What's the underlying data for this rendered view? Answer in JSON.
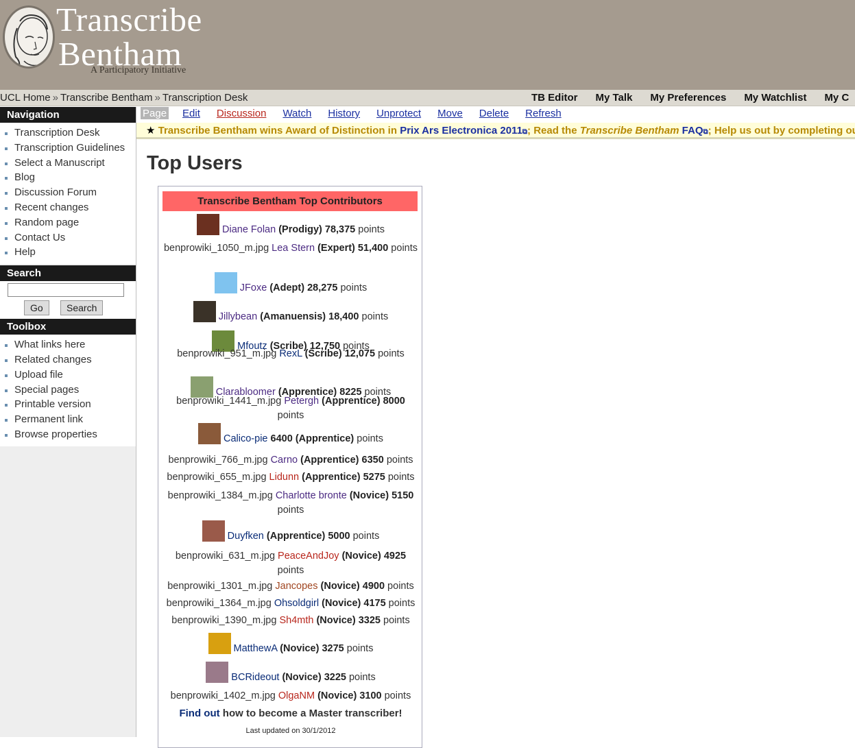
{
  "header": {
    "title_line1": "Transcribe",
    "title_line2": "Bentham",
    "tagline": "A Participatory Initiative"
  },
  "breadcrumb": [
    "UCL Home",
    "Transcribe Bentham",
    "Transcription Desk"
  ],
  "personal_links": [
    "TB Editor",
    "My Talk",
    "My Preferences",
    "My Watchlist",
    "My C"
  ],
  "sidebar": {
    "navigation": {
      "heading": "Navigation",
      "items": [
        "Transcription Desk",
        "Transcription Guidelines",
        "Select a Manuscript",
        "Blog",
        "Discussion Forum",
        "Recent changes",
        "Random page",
        "Contact Us",
        "Help"
      ]
    },
    "search": {
      "heading": "Search",
      "input_value": "",
      "go_label": "Go",
      "search_label": "Search"
    },
    "toolbox": {
      "heading": "Toolbox",
      "items": [
        "What links here",
        "Related changes",
        "Upload file",
        "Special pages",
        "Printable version",
        "Permanent link",
        "Browse properties"
      ]
    }
  },
  "tabs": [
    "Page",
    "Edit",
    "Discussion",
    "Watch",
    "History",
    "Unprotect",
    "Move",
    "Delete",
    "Refresh"
  ],
  "sitenotice": {
    "star": "★",
    "part1": "Transcribe Bentham wins Award of Distinction in ",
    "link1": "Prix Ars Electronica 2011",
    "part2": "; Read the ",
    "em": "Transcribe Bentham",
    "link2": " FAQ",
    "part3": "; Help us out by completing ou"
  },
  "page_title": "Top Users",
  "contributors": {
    "heading": "Transcribe Bentham Top Contributors",
    "entries": [
      {
        "prefix": "",
        "name": "Diane Folan",
        "color": "#4b2a82",
        "rank": "(Prodigy)",
        "points": "78,375",
        "rank_first": true,
        "avatar": "#6b3020"
      },
      {
        "prefix": "benprowiki_1050_m.jpg",
        "name": "Lea Stern",
        "color": "#4b2a82",
        "rank": "(Expert)",
        "points": "51,400",
        "rank_first": true,
        "avatar": ""
      },
      {
        "prefix": "",
        "name": "JFoxe",
        "color": "#4b2a82",
        "rank": "(Adept)",
        "points": "28,275",
        "rank_first": true,
        "avatar": "#7fc3ef"
      },
      {
        "prefix": "",
        "name": "Jillybean",
        "color": "#4b2a82",
        "rank": "(Amanuensis)",
        "points": "18,400",
        "rank_first": true,
        "avatar": "#3a3228"
      },
      {
        "prefix": "",
        "name": "Mfoutz",
        "color": "#0a2c77",
        "rank": "(Scribe)",
        "points": "12,750",
        "rank_first": true,
        "avatar": "#6c8a3c"
      },
      {
        "prefix": "benprowiki_951_m.jpg",
        "name": "RexL",
        "color": "#0a2c77",
        "rank": "(Scribe)",
        "points": "12,075",
        "rank_first": true,
        "avatar": ""
      },
      {
        "prefix": "",
        "name": "Clarabloomer",
        "color": "#4b2a82",
        "rank": "(Apprentice)",
        "points": "8225",
        "rank_first": true,
        "avatar": "#8aa070"
      },
      {
        "prefix": "benprowiki_1441_m.jpg",
        "name": "Petergh",
        "color": "#4b2a82",
        "rank": "(Apprentice)",
        "points": "8000",
        "rank_first": true,
        "avatar": ""
      },
      {
        "prefix": "",
        "name": "Calico-pie",
        "color": "#0a2c77",
        "rank": "(Apprentice)",
        "points": "6400",
        "rank_first": false,
        "avatar": "#8a5a3a"
      },
      {
        "prefix": "benprowiki_766_m.jpg",
        "name": "Carno",
        "color": "#4b2a82",
        "rank": "(Apprentice)",
        "points": "6350",
        "rank_first": true,
        "avatar": ""
      },
      {
        "prefix": "benprowiki_655_m.jpg",
        "name": "Lidunn",
        "color": "#b8261c",
        "rank": "(Apprentice)",
        "points": "5275",
        "rank_first": true,
        "avatar": ""
      },
      {
        "prefix": "benprowiki_1384_m.jpg",
        "name": "Charlotte bronte",
        "color": "#4b2a82",
        "rank": "(Novice)",
        "points": "5150",
        "rank_first": true,
        "avatar": ""
      },
      {
        "prefix": "",
        "name": "Duyfken",
        "color": "#0a2c77",
        "rank": "(Apprentice)",
        "points": "5000",
        "rank_first": true,
        "avatar": "#9a5a4a"
      },
      {
        "prefix": "benprowiki_631_m.jpg",
        "name": "PeaceAndJoy",
        "color": "#b8261c",
        "rank": "(Novice)",
        "points": "4925",
        "rank_first": true,
        "avatar": ""
      },
      {
        "prefix": "benprowiki_1301_m.jpg",
        "name": "Jancopes",
        "color": "#a04520",
        "rank": "(Novice)",
        "points": "4900",
        "rank_first": true,
        "avatar": ""
      },
      {
        "prefix": "benprowiki_1364_m.jpg",
        "name": "Ohsoldgirl",
        "color": "#0a2c77",
        "rank": "(Novice)",
        "points": "4175",
        "rank_first": true,
        "avatar": ""
      },
      {
        "prefix": "benprowiki_1390_m.jpg",
        "name": "Sh4mth",
        "color": "#b8261c",
        "rank": "(Novice)",
        "points": "3325",
        "rank_first": true,
        "avatar": ""
      },
      {
        "prefix": "",
        "name": "MatthewA",
        "color": "#0a2c77",
        "rank": "(Novice)",
        "points": "3275",
        "rank_first": true,
        "avatar": "#d8a010"
      },
      {
        "prefix": "",
        "name": "BCRideout",
        "color": "#0a2c77",
        "rank": "(Novice)",
        "points": "3225",
        "rank_first": true,
        "avatar": "#9a7a8a"
      },
      {
        "prefix": "benprowiki_1402_m.jpg",
        "name": "OlgaNM",
        "color": "#b8261c",
        "rank": "(Novice)",
        "points": "3100",
        "rank_first": true,
        "avatar": ""
      }
    ],
    "points_word": "points",
    "find_out_link": "Find out",
    "find_out_text": " how to become a Master transcriber!",
    "updated": "Last updated on 30/1/2012"
  }
}
